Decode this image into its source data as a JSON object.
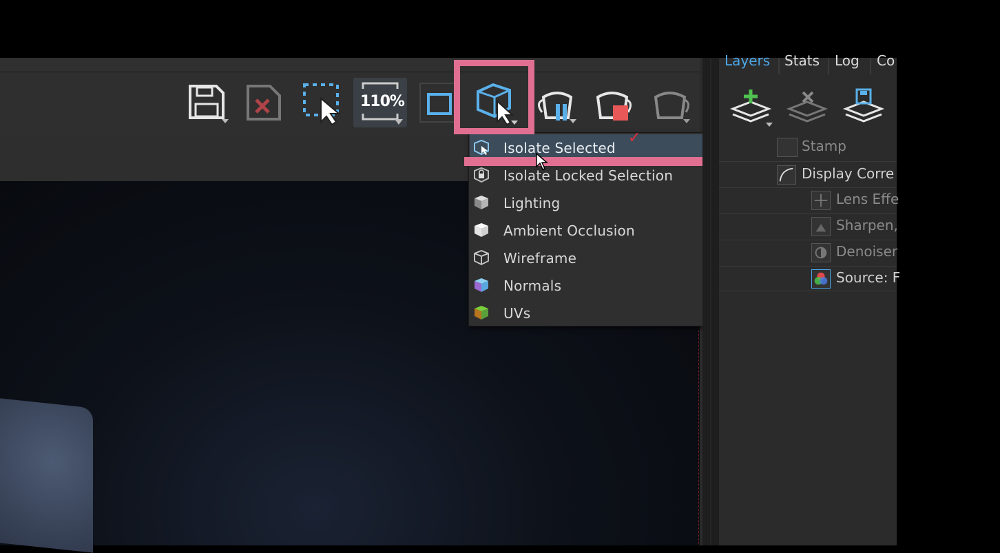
{
  "toolbar": {
    "zoom_label": "110%",
    "buttons": [
      "save-icon",
      "discard-icon",
      "region-select-icon",
      "zoom-icon",
      "frame-icon",
      "isolate-view-icon",
      "pause-render-icon",
      "stop-render-icon",
      "teapot-icon"
    ]
  },
  "dropdown": {
    "items": [
      {
        "label": "Isolate Selected",
        "icon": "isolate-selected-icon",
        "selected": true
      },
      {
        "label": "Isolate Locked Selection",
        "icon": "lock-icon",
        "selected": false
      },
      {
        "label": "Lighting",
        "icon": "lighting-cube-icon",
        "selected": false
      },
      {
        "label": "Ambient Occlusion",
        "icon": "ao-cube-icon",
        "selected": false
      },
      {
        "label": "Wireframe",
        "icon": "wireframe-cube-icon",
        "selected": false
      },
      {
        "label": "Normals",
        "icon": "normals-cube-icon",
        "selected": false
      },
      {
        "label": "UVs",
        "icon": "uvs-cube-icon",
        "selected": false
      }
    ],
    "checkmark": "✓"
  },
  "right_panel": {
    "tabs": [
      "Layers",
      "Stats",
      "Log",
      "Co"
    ],
    "active_tab": "Layers",
    "layers": [
      {
        "label": "Stamp",
        "dim": true
      },
      {
        "label": "Display Corre",
        "dim": false
      },
      {
        "label": "Lens Effe",
        "dim": true
      },
      {
        "label": "Sharpen,",
        "dim": true
      },
      {
        "label": "Denoiser",
        "dim": true
      },
      {
        "label": "Source: F",
        "dim": false
      }
    ]
  },
  "colors": {
    "highlight": "#e06f92",
    "accent_blue": "#4aa6e6",
    "selected_row": "#3d4c5a"
  }
}
